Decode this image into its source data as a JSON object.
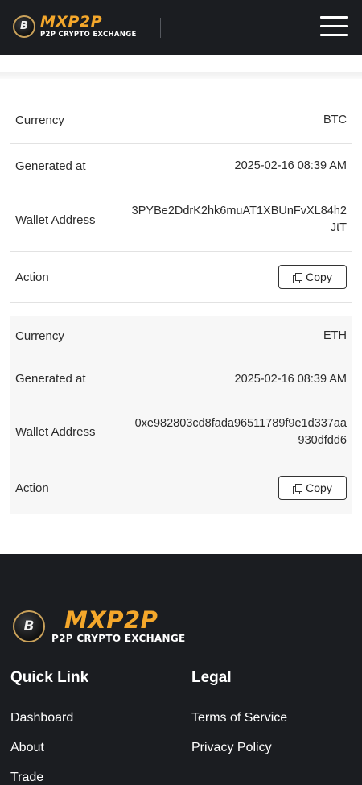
{
  "header": {
    "logo_coin": "B",
    "brand": "MXP2P",
    "tagline": "P2P CRYPTO EXCHANGE",
    "menu_icon": "hamburger-menu-icon"
  },
  "wallets": [
    {
      "currency_label": "Currency",
      "currency": "BTC",
      "generated_label": "Generated at",
      "generated_at": "2025-02-16 08:39 AM",
      "address_label": "Wallet Address",
      "address": "3PYBe2DdrK2hk6muAT1XBUnFvXL84h2JtT",
      "action_label": "Action",
      "copy_label": "Copy"
    },
    {
      "currency_label": "Currency",
      "currency": "ETH",
      "generated_label": "Generated at",
      "generated_at": "2025-02-16 08:39 AM",
      "address_label": "Wallet Address",
      "address": "0xe982803cd8fada96511789f9e1d337aa930dfdd6",
      "action_label": "Action",
      "copy_label": "Copy"
    }
  ],
  "footer": {
    "logo_coin": "B",
    "brand": "MXP2P",
    "tagline": "P2P CRYPTO EXCHANGE",
    "quick_link_heading": "Quick Link",
    "quick_links": [
      "Dashboard",
      "About",
      "Trade"
    ],
    "legal_heading": "Legal",
    "legal_links": [
      "Terms of Service",
      "Privacy Policy"
    ]
  },
  "colors": {
    "dark_bg": "#1b1d21",
    "brand_orange": "#f4a72b",
    "alt_card_bg": "#f7f7f7"
  }
}
